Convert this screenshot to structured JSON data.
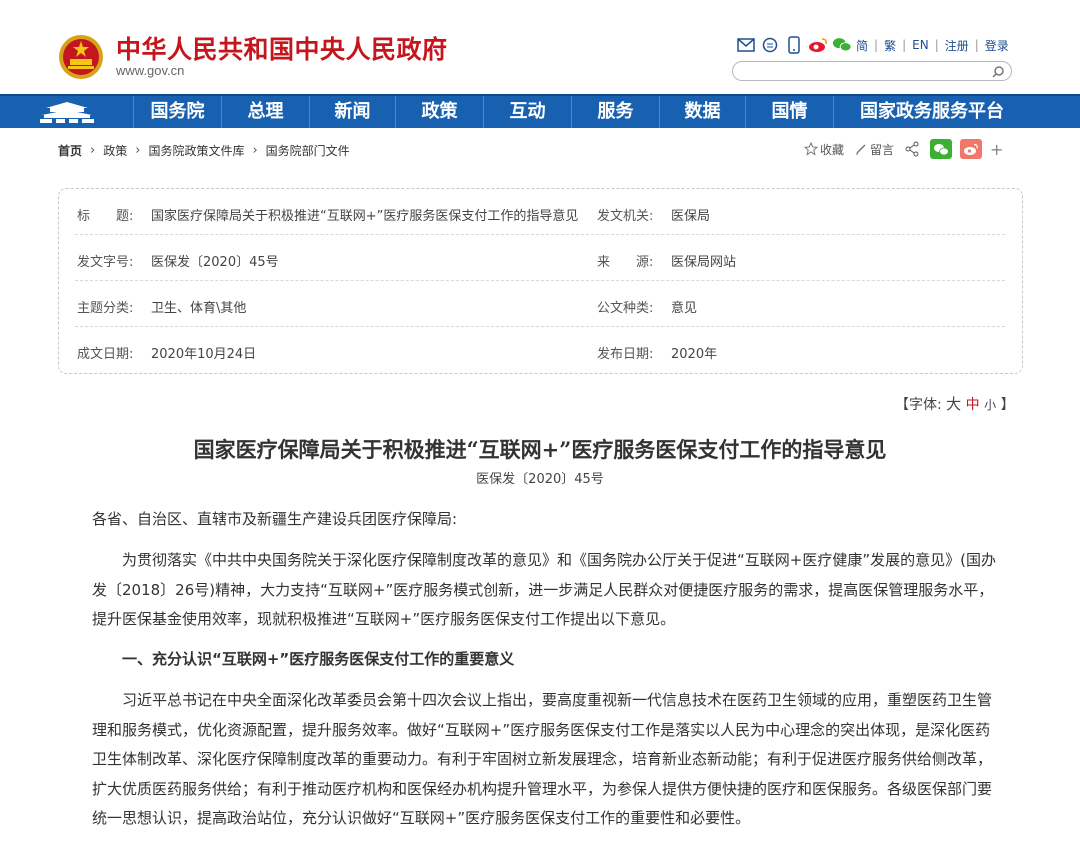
{
  "header": {
    "site_title": "中华人民共和国中央人民政府",
    "site_domain": "www.gov.cn",
    "icons": [
      "mail-icon",
      "message-icon",
      "mobile-icon",
      "weibo-icon",
      "wechat-icon"
    ],
    "lang_links": [
      "简",
      "繁",
      "EN"
    ],
    "account_links": [
      "注册",
      "登录"
    ],
    "search_placeholder": "",
    "brand_color": "#c4161c"
  },
  "nav": {
    "home_icon": "tiananmen-icon",
    "items": [
      "国务院",
      "总理",
      "新闻",
      "政策",
      "互动",
      "服务",
      "数据",
      "国情",
      "国家政务服务平台"
    ],
    "bg_color": "#1861b1"
  },
  "breadcrumb": [
    "首页",
    "政策",
    "国务院政策文件库",
    "国务院部门文件"
  ],
  "share": {
    "favorite": "收藏",
    "comment": "留言"
  },
  "meta": {
    "rows": [
      {
        "l1": "标　　题:",
        "v1": "国家医疗保障局关于积极推进“互联网+”医疗服务医保支付工作的指导意见",
        "l2": "发文机关:",
        "v2": "医保局"
      },
      {
        "l1": "发文字号:",
        "v1": "医保发〔2020〕45号",
        "l2": "来　　源:",
        "v2": "医保局网站"
      },
      {
        "l1": "主题分类:",
        "v1": "卫生、体育\\其他",
        "l2": "公文种类:",
        "v2": "意见"
      },
      {
        "l1": "成文日期:",
        "v1": "2020年10月24日",
        "l2": "发布日期:",
        "v2": "2020年"
      }
    ]
  },
  "fontsize": {
    "open": "【字体:",
    "big": "大",
    "mid": "中",
    "small": "小",
    "close": "】"
  },
  "article": {
    "title": "国家医疗保障局关于积极推进“互联网+”医疗服务医保支付工作的指导意见",
    "doc_no": "医保发〔2020〕45号",
    "salutation": "各省、自治区、直辖市及新疆生产建设兵团医疗保障局:",
    "para1": "为贯彻落实《中共中央国务院关于深化医疗保障制度改革的意见》和《国务院办公厅关于促进“互联网+医疗健康”发展的意见》(国办发〔2018〕26号)精神，大力支持“互联网+”医疗服务模式创新，进一步满足人民群众对便捷医疗服务的需求，提高医保管理服务水平，提升医保基金使用效率，现就积极推进“互联网+”医疗服务医保支付工作提出以下意见。",
    "heading1": "一、充分认识“互联网+”医疗服务医保支付工作的重要意义",
    "para2": "习近平总书记在中央全面深化改革委员会第十四次会议上指出，要高度重视新一代信息技术在医药卫生领域的应用，重塑医药卫生管理和服务模式，优化资源配置，提升服务效率。做好“互联网+”医疗服务医保支付工作是落实以人民为中心理念的突出体现，是深化医药卫生体制改革、深化医疗保障制度改革的重要动力。有利于牢固树立新发展理念，培育新业态新动能；有利于促进医疗服务供给侧改革，扩大优质医药服务供给；有利于推动医疗机构和医保经办机构提升管理水平，为参保人提供方便快捷的医疗和医保服务。各级医保部门要统一思想认识，提高政治站位，充分认识做好“互联网+”医疗服务医保支付工作的重要性和必要性。"
  }
}
